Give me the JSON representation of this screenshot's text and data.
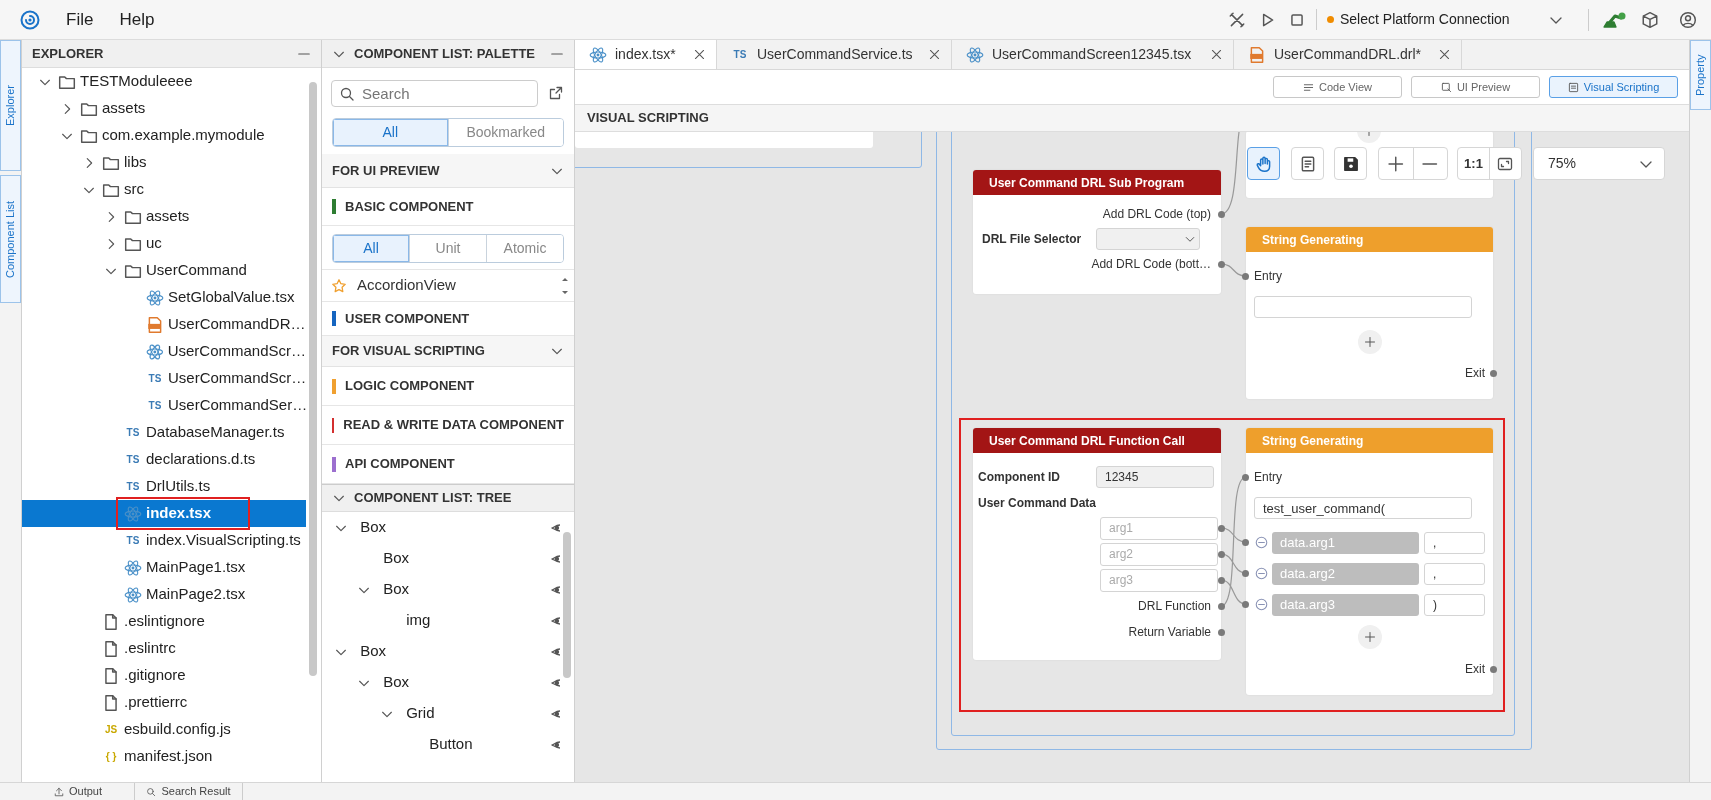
{
  "menu_bar": {
    "items": [
      "File",
      "Help"
    ]
  },
  "top_toolbar": {
    "connection": "Select Platform Connection"
  },
  "left_side_tabs": [
    "Explorer",
    "Component List"
  ],
  "right_side_tabs": [
    "Property"
  ],
  "explorer": {
    "title": "EXPLORER",
    "tree": [
      {
        "label": "TESTModuleeee",
        "kind": "folder",
        "expanded": true,
        "selected": false,
        "annotated": false,
        "children": [
          {
            "label": "assets",
            "kind": "folder",
            "expanded": false,
            "selected": false,
            "annotated": false
          },
          {
            "label": "com.example.mymodule",
            "kind": "folder",
            "expanded": true,
            "selected": false,
            "annotated": false,
            "children": [
              {
                "label": "libs",
                "kind": "folder",
                "expanded": false,
                "selected": false,
                "annotated": false
              },
              {
                "label": "src",
                "kind": "folder",
                "expanded": true,
                "selected": false,
                "annotated": false,
                "children": [
                  {
                    "label": "assets",
                    "kind": "folder",
                    "expanded": false,
                    "selected": false,
                    "annotated": false
                  },
                  {
                    "label": "uc",
                    "kind": "folder",
                    "expanded": false,
                    "selected": false,
                    "annotated": false
                  },
                  {
                    "label": "UserCommand",
                    "kind": "folder",
                    "expanded": true,
                    "selected": false,
                    "annotated": false,
                    "children": [
                      {
                        "label": "SetGlobalValue.tsx",
                        "kind": "react",
                        "selected": false,
                        "annotated": false
                      },
                      {
                        "label": "UserCommandDR…",
                        "kind": "drl",
                        "selected": false,
                        "annotated": false
                      },
                      {
                        "label": "UserCommandScr…",
                        "kind": "react",
                        "selected": false,
                        "annotated": false
                      },
                      {
                        "label": "UserCommandScr…",
                        "kind": "ts",
                        "badge": "TS",
                        "selected": false,
                        "annotated": false
                      },
                      {
                        "label": "UserCommandSer…",
                        "kind": "ts",
                        "badge": "TS",
                        "selected": false,
                        "annotated": false
                      }
                    ]
                  },
                  {
                    "label": "DatabaseManager.ts",
                    "kind": "ts",
                    "badge": "TS",
                    "selected": false,
                    "annotated": false
                  },
                  {
                    "label": "declarations.d.ts",
                    "kind": "ts",
                    "badge": "TS",
                    "selected": false,
                    "annotated": false
                  },
                  {
                    "label": "DrlUtils.ts",
                    "kind": "ts",
                    "badge": "TS",
                    "selected": false,
                    "annotated": false
                  },
                  {
                    "label": "index.tsx",
                    "kind": "react",
                    "selected": true,
                    "annotated": true
                  },
                  {
                    "label": "index.VisualScripting.ts",
                    "kind": "ts",
                    "badge": "TS",
                    "selected": false,
                    "annotated": false
                  },
                  {
                    "label": "MainPage1.tsx",
                    "kind": "react",
                    "selected": false,
                    "annotated": false
                  },
                  {
                    "label": "MainPage2.tsx",
                    "kind": "react",
                    "selected": false,
                    "annotated": false
                  }
                ]
              },
              {
                "label": ".eslintignore",
                "kind": "file",
                "selected": false,
                "annotated": false
              },
              {
                "label": ".eslintrc",
                "kind": "file",
                "selected": false,
                "annotated": false
              },
              {
                "label": ".gitignore",
                "kind": "file",
                "selected": false,
                "annotated": false
              },
              {
                "label": ".prettierrc",
                "kind": "file",
                "selected": false,
                "annotated": false
              },
              {
                "label": "esbuild.config.js",
                "kind": "js",
                "badge": "JS",
                "selected": false,
                "annotated": false
              },
              {
                "label": "manifest.json",
                "kind": "json",
                "badge": "{ }",
                "selected": false,
                "annotated": false
              }
            ]
          }
        ]
      }
    ]
  },
  "palette": {
    "title": "COMPONENT LIST: PALETTE",
    "search": {
      "placeholder": "Search"
    },
    "filters": [
      {
        "label": "All",
        "selected": true
      },
      {
        "label": "Bookmarked",
        "selected": false
      }
    ],
    "sections": [
      {
        "title": "FOR UI PREVIEW",
        "expanded": true,
        "groups": [
          {
            "title": "BASIC COMPONENT",
            "color": "#2e7d32",
            "filters": [
              {
                "label": "All",
                "selected": true
              },
              {
                "label": "Unit",
                "selected": false
              },
              {
                "label": "Atomic",
                "selected": false
              }
            ],
            "items": [
              {
                "label": "AccordionView",
                "bookmarked": false
              }
            ]
          },
          {
            "title": "USER COMPONENT",
            "color": "#1565c0"
          }
        ]
      },
      {
        "title": "FOR VISUAL SCRIPTING",
        "expanded": true,
        "groups": [
          {
            "title": "LOGIC COMPONENT",
            "color": "#f0a030"
          },
          {
            "title": "READ & WRITE DATA COMPONENT",
            "color": "#d32f2f"
          },
          {
            "title": "API COMPONENT",
            "color": "#9c6fcf"
          }
        ]
      }
    ]
  },
  "component_tree": {
    "title": "COMPONENT LIST: TREE",
    "expanded": true,
    "items": [
      {
        "label": "Box",
        "expanded": true,
        "children": [
          {
            "label": "Box"
          },
          {
            "label": "Box",
            "expanded": true,
            "children": [
              {
                "label": "img"
              }
            ]
          }
        ]
      },
      {
        "label": "Box",
        "expanded": true,
        "children": [
          {
            "label": "Box",
            "expanded": true,
            "children": [
              {
                "label": "Grid",
                "expanded": true,
                "children": [
                  {
                    "label": "Button"
                  }
                ]
              }
            ]
          }
        ]
      }
    ]
  },
  "editor": {
    "tabs": [
      {
        "label": "index.tsx*",
        "kind": "react",
        "selected": true
      },
      {
        "label": "UserCommandService.ts",
        "kind": "ts",
        "badge": "TS",
        "selected": false
      },
      {
        "label": "UserCommandScreen12345.tsx",
        "kind": "react",
        "selected": false
      },
      {
        "label": "UserCommandDRL.drl*",
        "kind": "drl",
        "selected": false
      }
    ],
    "views": [
      {
        "label": "Code View",
        "kind": "code",
        "selected": false
      },
      {
        "label": "UI Preview",
        "kind": "preview",
        "selected": false
      },
      {
        "label": "Visual Scripting",
        "kind": "scripting",
        "selected": true
      }
    ],
    "section_title": "VISUAL SCRIPTING",
    "canvas": {
      "toolbar": {
        "hand_selected": true,
        "actual_size": "1:1",
        "zoom": "75%"
      },
      "nodes": [
        {
          "kind": "fragment",
          "selected": false
        },
        {
          "kind": "sub_program",
          "title": "User Command DRL Sub Program",
          "selected": false,
          "outputs": [
            "Add DRL Code (top)",
            "Add DRL Code (bott…"
          ],
          "selector_label": "DRL File Selector"
        },
        {
          "kind": "string",
          "title": "String Generating",
          "selected": false,
          "entry": "Entry",
          "exit": "Exit"
        },
        {
          "kind": "function_call",
          "title": "User Command DRL Function Call",
          "selected": true,
          "id_label": "Component ID",
          "id_value": "12345",
          "data_label": "User Command Data",
          "args": [
            {
              "placeholder": "arg1"
            },
            {
              "placeholder": "arg2"
            },
            {
              "placeholder": "arg3"
            }
          ],
          "function_output": "DRL Function",
          "return_output": "Return Variable"
        },
        {
          "kind": "string",
          "title": "String Generating",
          "selected": true,
          "entry": "Entry",
          "prefix": "test_user_command(",
          "args": [
            {
              "variable": "data.arg1",
              "suffix": ","
            },
            {
              "variable": "data.arg2",
              "suffix": ","
            },
            {
              "variable": "data.arg3",
              "suffix": ")"
            }
          ],
          "exit": "Exit"
        }
      ]
    }
  },
  "bottom_tabs": [
    {
      "label": "Output",
      "kind": "output"
    },
    {
      "label": "Search Result",
      "kind": "search"
    }
  ]
}
